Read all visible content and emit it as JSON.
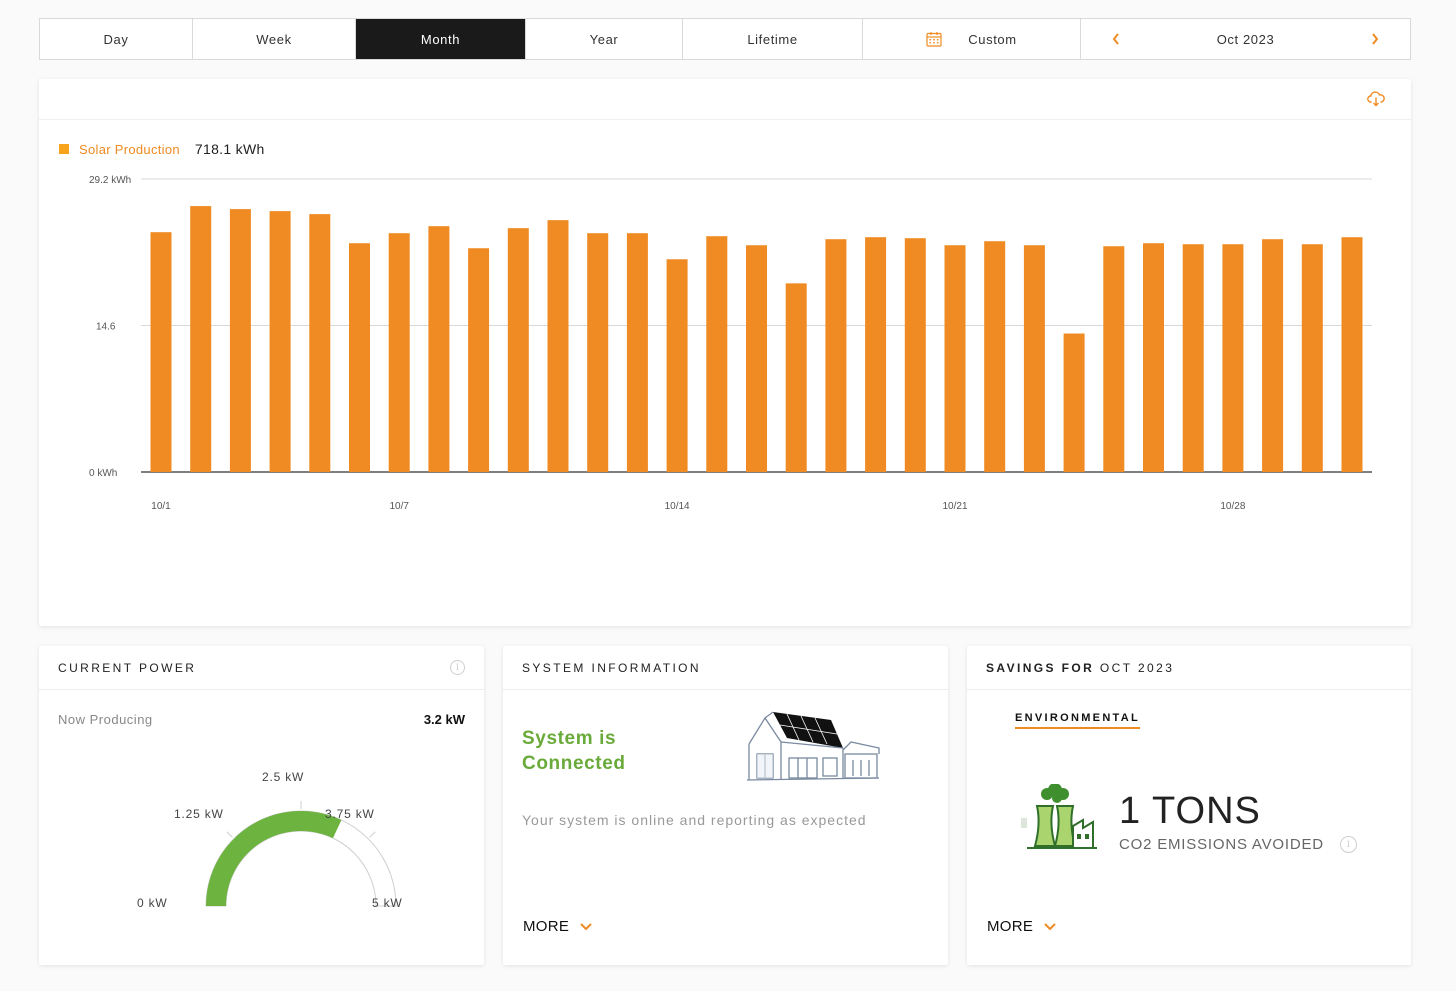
{
  "tabs": [
    {
      "label": "Day",
      "width": 153,
      "active": false
    },
    {
      "label": "Week",
      "width": 163,
      "active": false
    },
    {
      "label": "Month",
      "width": 170,
      "active": true
    },
    {
      "label": "Year",
      "width": 157,
      "active": false
    },
    {
      "label": "Lifetime",
      "width": 180,
      "active": false
    }
  ],
  "custom_tab": {
    "label": "Custom",
    "icon": "calendar-icon"
  },
  "date_nav": {
    "label": "Oct 2023",
    "prev_icon": "chevron-left-icon",
    "next_icon": "chevron-right-icon"
  },
  "chart_card": {
    "download_icon": "cloud-download-icon"
  },
  "legend": {
    "series_name": "Solar Production",
    "total": "718.1 kWh",
    "color": "#f7a41c"
  },
  "chart_data": {
    "type": "bar",
    "series_name": "Solar Production",
    "unit": "kWh",
    "ylim": [
      0,
      29.2
    ],
    "y_ticks": [
      {
        "value": 0,
        "label": "0 kWh"
      },
      {
        "value": 14.6,
        "label": "14.6"
      },
      {
        "value": 29.2,
        "label": "29.2 kWh"
      }
    ],
    "categories": [
      "10/1",
      "10/2",
      "10/3",
      "10/4",
      "10/5",
      "10/6",
      "10/7",
      "10/8",
      "10/9",
      "10/10",
      "10/11",
      "10/12",
      "10/13",
      "10/14",
      "10/15",
      "10/16",
      "10/17",
      "10/18",
      "10/19",
      "10/20",
      "10/21",
      "10/22",
      "10/23",
      "10/24",
      "10/25",
      "10/26",
      "10/27",
      "10/28",
      "10/29",
      "10/30",
      "10/31"
    ],
    "x_tick_labels": [
      "10/1",
      "10/7",
      "10/14",
      "10/21",
      "10/28"
    ],
    "values": [
      23.9,
      26.5,
      26.2,
      26.0,
      25.7,
      22.8,
      23.8,
      24.5,
      22.3,
      24.3,
      25.1,
      23.8,
      23.8,
      21.2,
      23.5,
      22.6,
      18.8,
      23.2,
      23.4,
      23.3,
      22.6,
      23.0,
      22.6,
      13.8,
      22.5,
      22.8,
      22.7,
      22.7,
      23.2,
      22.7,
      23.4
    ],
    "bar_color": "#ef8b22",
    "grid": true
  },
  "current_power": {
    "title": "CURRENT POWER",
    "label": "Now Producing",
    "value": "3.2 kW",
    "value_kw": 3.2,
    "max_kw": 5,
    "gauge_labels": [
      "0 kW",
      "1.25 kW",
      "2.5 kW",
      "3.75 kW",
      "5 kW"
    ],
    "gauge_color": "#6db33f"
  },
  "system_info": {
    "title": "SYSTEM INFORMATION",
    "status_line1": "System is",
    "status_line2": "Connected",
    "description": "Your system is online and reporting as expected",
    "more_label": "MORE",
    "status_color": "#6aaa3a"
  },
  "savings": {
    "title_bold": "SAVINGS FOR",
    "title_period": "OCT 2023",
    "tab_label": "ENVIRONMENTAL",
    "amount": "1 TONS",
    "caption": "CO2 EMISSIONS AVOIDED",
    "more_label": "MORE"
  }
}
